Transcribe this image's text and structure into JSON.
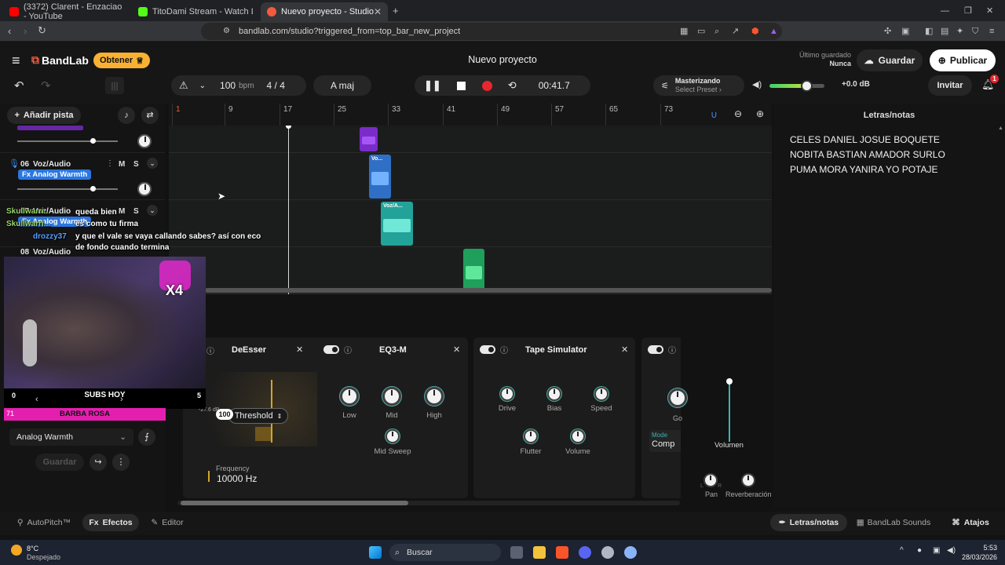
{
  "browser": {
    "tabs": [
      {
        "title": "(3372) Clarent - Enzaciao - YouTube",
        "color": "#ff0000"
      },
      {
        "title": "TitoDami Stream - Watch Live on Kic",
        "color": "#53fc18"
      },
      {
        "title": "Nuevo proyecto - Studio",
        "color": "#f25c3d"
      }
    ],
    "url": "bandlab.com/studio?triggered_from=top_bar_new_project",
    "window_controls": [
      "—",
      "❐",
      "✕"
    ]
  },
  "header": {
    "logo": "BandLab",
    "obtener": "Obtener",
    "project_title": "Nuevo proyecto",
    "last_saved_label": "Último guardado",
    "last_saved_value": "Nunca",
    "guardar": "Guardar",
    "publicar": "Publicar",
    "bpm_value": "100",
    "bpm_unit": "bpm",
    "time_signature": "4 / 4",
    "key": "A maj",
    "time": "00:41.7",
    "mastering_label": "Masterizando",
    "mastering_preset": "Select Preset",
    "volume_db": "+0.0 dB",
    "invitar": "Invitar",
    "notif_count": "1",
    "master_volume_level": 0.6
  },
  "left": {
    "add_track": "Añadir pista",
    "tracks": [
      {
        "num": "06",
        "name": "Voz/Audio",
        "fx": "Fx Analog Warmth"
      },
      {
        "num": "07",
        "name": "Voz/Audio",
        "fx": "Fx Analog Warmth"
      },
      {
        "num": "08",
        "name": "Voz/Audio",
        "fx": ""
      }
    ],
    "ms_m": "M",
    "ms_s": "S",
    "preset_name": "Analog Warmth",
    "save_preset": "Guardar"
  },
  "ruler": {
    "marks": [
      "1",
      "9",
      "17",
      "25",
      "33",
      "41",
      "49",
      "57",
      "65",
      "73"
    ]
  },
  "clips": [
    {
      "label": "",
      "color": "#7a2cc8"
    },
    {
      "label": "Vo...",
      "color": "#2f6fc6"
    },
    {
      "label": "Voz/A...",
      "color": "#23a29a"
    },
    {
      "label": "",
      "color": "#1f9e5c"
    }
  ],
  "lyrics": {
    "title": "Letras/notas",
    "text": "CELES DANIEL JOSUE BOQUETE NOBITA BASTIAN AMADOR SURLO PUMA MORA YANIRA YO POTAJE"
  },
  "effects": {
    "deesser": {
      "title": "DeEsser",
      "db": "-27.6 dB",
      "threshold": "Threshold",
      "freq_label": "Frequency",
      "freq_value": "10000 Hz"
    },
    "eq3m": {
      "title": "EQ3-M",
      "low": "Low",
      "mid": "Mid",
      "high": "High",
      "mid_sweep": "Mid Sweep"
    },
    "tape": {
      "title": "Tape Simulator",
      "drive": "Drive",
      "bias": "Bias",
      "speed": "Speed",
      "flutter": "Flutter",
      "volume": "Volume"
    },
    "partial": {
      "mode": "Mode",
      "mode_value": "Comp",
      "knob_label": "Go"
    },
    "volume_label": "Volumen",
    "pan_label": "Pan",
    "reverb_label": "Reverberación",
    "pan_l": "L",
    "pan_r": "R"
  },
  "bottom": {
    "autopitch": "AutoPitch™",
    "efectos": "Efectos",
    "editor": "Editor",
    "letras": "Letras/notas",
    "sounds": "BandLab Sounds",
    "atajos": "Atajos"
  },
  "overlay": {
    "chat": [
      {
        "user": "Skullwarri...",
        "msg": "queda bien"
      },
      {
        "user": "Skullwarri...",
        "msg": "es como tu firma"
      },
      {
        "user": "drozzy37",
        "msg": "y que el vale se vaya callando sabes? así con eco"
      },
      {
        "user": "",
        "msg": "de fondo cuando termina"
      }
    ],
    "x4": "X4",
    "subs_label": "SUBS HOY",
    "subs_from": "0",
    "subs_to": "5",
    "barba_num": "71",
    "barba_label": "BARBA ROSA",
    "barba_value": "100"
  },
  "taskbar": {
    "weather_temp": "8°C",
    "weather_desc": "Despejado",
    "search": "Buscar",
    "time": "5:53",
    "date": "28/03/2026"
  }
}
